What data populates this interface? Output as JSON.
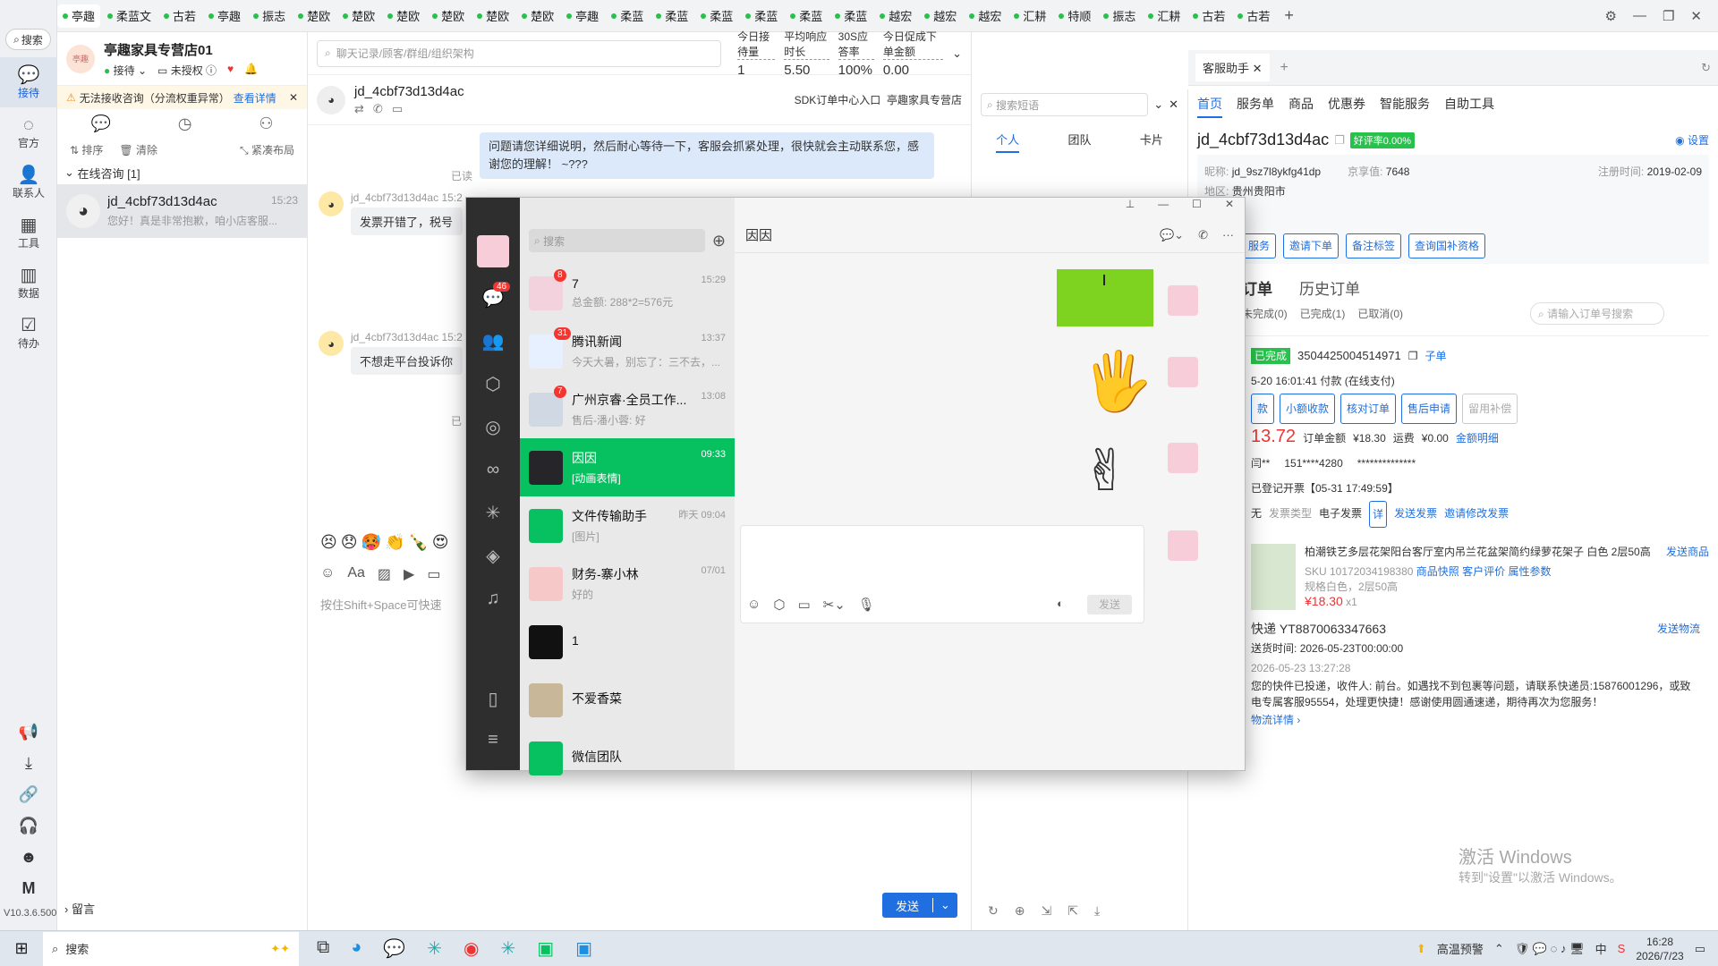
{
  "tabs": [
    "亭趣",
    "柔蓝文",
    "古若",
    "亭趣",
    "振志",
    "楚欧",
    "楚欧",
    "楚欧",
    "楚欧",
    "楚欧",
    "楚欧",
    "亭趣",
    "柔蓝",
    "柔蓝",
    "柔蓝",
    "柔蓝",
    "柔蓝",
    "柔蓝",
    "越宏",
    "越宏",
    "越宏",
    "汇耕",
    "特顺",
    "振志",
    "汇耕",
    "古若",
    "古若"
  ],
  "rail": {
    "search": "搜索",
    "items": [
      {
        "label": "接待",
        "icon": "chat-bubble-icon"
      },
      {
        "label": "官方",
        "icon": "message-icon"
      },
      {
        "label": "联系人",
        "icon": "person-icon"
      },
      {
        "label": "工具",
        "icon": "grid-icon"
      },
      {
        "label": "数据",
        "icon": "chart-icon"
      },
      {
        "label": "待办",
        "icon": "todo-icon"
      }
    ],
    "version": "V10.3.6.500",
    "m": "M"
  },
  "shop": {
    "name": "亭趣家具专营店01",
    "status": "接待",
    "auth": "未授权"
  },
  "warning": {
    "text": "无法接收咨询（分流权重异常）",
    "link": "查看详情"
  },
  "conv": {
    "sort": "排序",
    "clear": "清除",
    "layout": "紧凑布局",
    "group": "在线咨询 [1]",
    "items": [
      {
        "name": "jd_4cbf73d13d4ac",
        "time": "15:23",
        "preview": "您好！真是非常抱歉，咱小店客服..."
      }
    ],
    "bottom": "留言"
  },
  "search": {
    "placeholder": "聊天记录/顾客/群组/组织架构"
  },
  "stats": [
    {
      "label": "今日接待量",
      "value": "1"
    },
    {
      "label": "平均响应时长",
      "value": "5.50"
    },
    {
      "label": "30S应答率",
      "value": "100%"
    },
    {
      "label": "今日促成下单金额",
      "value": "0.00"
    }
  ],
  "chat": {
    "user": "jd_4cbf73d13d4ac",
    "sdk": "SDK订单中心入口",
    "shop": "亭趣家具专营店",
    "bubble": "问题请您详细说明，然后耐心等待一下，客服会抓紧处理，很快就会主动联系您，感谢您的理解！ ~???",
    "read": "已读",
    "msg1_user": "jd_4cbf73d13d4ac",
    "msg1_time": "15:2",
    "msg1": "发票开错了，税号",
    "msg2_user": "jd_4cbf73d13d4ac",
    "msg2_time": "15:2",
    "msg2": "不想走平台投诉你",
    "read2": "已",
    "hint": "按住Shift+Space可快速",
    "send": "发送"
  },
  "quick": {
    "placeholder": "搜索短语",
    "tabs": [
      "个人",
      "团队",
      "卡片"
    ]
  },
  "assist": {
    "tab": "客服助手",
    "nav": [
      "首页",
      "服务单",
      "商品",
      "优惠券",
      "智能服务",
      "自助工具"
    ],
    "user": "jd_4cbf73d13d4ac",
    "goodrate": "好评率0.00%",
    "settings": "设置",
    "nick_label": "昵称:",
    "nick": "jd_9sz7l8ykfg41dp",
    "jx_label": "京享值:",
    "jx": "7648",
    "reg_label": "注册时间:",
    "reg": "2019-02-09",
    "region_label": "地区:",
    "region": "贵州贵阳市",
    "btns": [
      "服务",
      "邀请下单",
      "备注标签",
      "查询国补资格"
    ],
    "orders_title": "订单",
    "history": "历史订单",
    "order_tabs": [
      "未完成(0)",
      "已完成(1)",
      "已取消(0)"
    ],
    "order_search": "请输入订单号搜索",
    "order_state": "已完成",
    "order_no": "3504425004514971",
    "suborder": "子单",
    "order_time": "5-20 16:01:41",
    "pay": "付款",
    "pay_type": "(在线支付)",
    "order_btns": [
      "款",
      "小额收款",
      "核对订单",
      "售后申请",
      "留用补偿"
    ],
    "price": "13.72",
    "amount_label": "订单金额",
    "amount": "¥18.30",
    "ship_label": "运费",
    "ship": "¥0.00",
    "detail": "金额明细",
    "buyer": "闫**",
    "phone": "151****4280",
    "hidden": "**************",
    "invoice": "已登记开票【05-31 17:49:59】",
    "inv_none": "无",
    "inv_type_label": "发票类型",
    "inv_type": "电子发票",
    "inv_detail": "详",
    "send_inv": "发送发票",
    "invite_inv": "邀请修改发票",
    "product": "柏潮铁艺多层花架阳台客厅室内吊兰花盆架简约绿萝花架子 白色 2层50高",
    "send_product": "发送商品",
    "sku": "SKU 10172034198380",
    "snap": "商品快照",
    "review": "客户评价",
    "attr": "属性参数",
    "spec": "规格白色，2层50高",
    "pprice": "¥18.30",
    "qty": "x1",
    "express": "快递 YT8870063347663",
    "send_logi": "发送物流",
    "deliv": "送货时间:",
    "deliv_time": "2026-05-23T00:00:00",
    "logi_time": "2026-05-23 13:27:28",
    "logi_text": "您的快件已投递，收件人: 前台。如遇找不到包裹等问题，请联系快递员:15876001296，或致电专属客服95554，处理更快捷！感谢使用圆通速递，期待再次为您服务！",
    "logi_link": "物流详情",
    "activate1": "激活 Windows",
    "activate2": "转到\"设置\"以激活 Windows。"
  },
  "wechat": {
    "search": "搜索",
    "title": "因因",
    "chats": [
      {
        "name": "7",
        "preview": "总金额: 288*2=576元",
        "time": "15:29",
        "badge": "8"
      },
      {
        "name": "腾讯新闻",
        "preview": "今天大暑，别忘了：三不去，...",
        "time": "13:37",
        "badge": "31"
      },
      {
        "name": "广州京睿·全员工作...",
        "preview": "售后-潘小蓉: 好",
        "time": "13:08",
        "badge": "7"
      },
      {
        "name": "因因",
        "preview": "[动画表情]",
        "time": "09:33",
        "badge": ""
      },
      {
        "name": "文件传输助手",
        "preview": "[图片]",
        "time": "昨天 09:04",
        "badge": ""
      },
      {
        "name": "财务-寨小林",
        "preview": "好的",
        "time": "07/01",
        "badge": ""
      },
      {
        "name": "1",
        "preview": "",
        "time": "",
        "badge": ""
      },
      {
        "name": "不爱香菜",
        "preview": "",
        "time": "",
        "badge": ""
      },
      {
        "name": "微信团队",
        "preview": "",
        "time": "",
        "badge": ""
      }
    ],
    "unread": "46",
    "send": "发送"
  },
  "taskbar": {
    "search": "搜索",
    "weather": "高温预警",
    "time": "16:28",
    "date": "2026/7/23",
    "lang": "中"
  }
}
